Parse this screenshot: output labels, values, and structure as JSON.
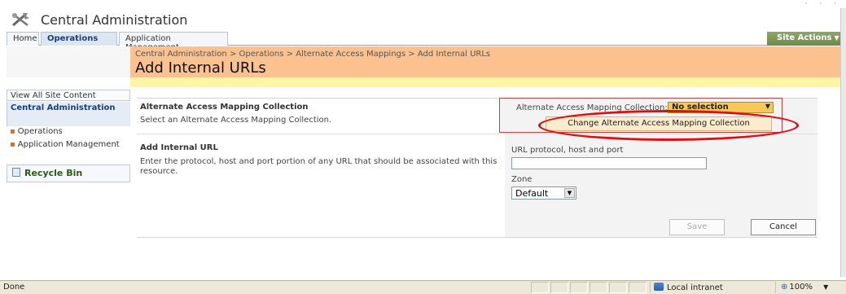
{
  "app": {
    "title": "Central Administration"
  },
  "tabs": {
    "home": "Home",
    "operations": "Operations",
    "application_management": "Application Management",
    "site_actions": "Site Actions",
    "site_actions_arrow": "▼"
  },
  "header": {
    "breadcrumb": "Central Administration > Operations > Alternate Access Mappings > Add Internal URLs",
    "page_title": "Add Internal URLs"
  },
  "left_nav": {
    "view_all": "View All Site Content",
    "section_title": "Central Administration",
    "items": [
      {
        "label": "Operations"
      },
      {
        "label": "Application Management"
      }
    ],
    "recycle_bin": "Recycle Bin"
  },
  "form": {
    "aamc": {
      "title": "Alternate Access Mapping Collection",
      "description": "Select an Alternate Access Mapping Collection.",
      "field_label": "Alternate Access Mapping Collection:",
      "selected": "No selection",
      "change_button": "Change Alternate Access Mapping Collection"
    },
    "internal_url": {
      "title": "Add Internal URL",
      "description": "Enter the protocol, host and port portion of any URL that should be associated with this resource.",
      "url_label": "URL protocol, host and port",
      "url_value": "",
      "zone_label": "Zone",
      "zone_selected": "Default"
    },
    "buttons": {
      "save": "Save",
      "cancel": "Cancel"
    }
  },
  "statusbar": {
    "status": "Done",
    "zone": "Local intranet",
    "zoom": "100%"
  },
  "colors": {
    "title_area": "#fbc28f",
    "yellow_strip": "#fdf5a6",
    "site_actions": "#6e8a47",
    "highlight_oval": "#e01010"
  }
}
